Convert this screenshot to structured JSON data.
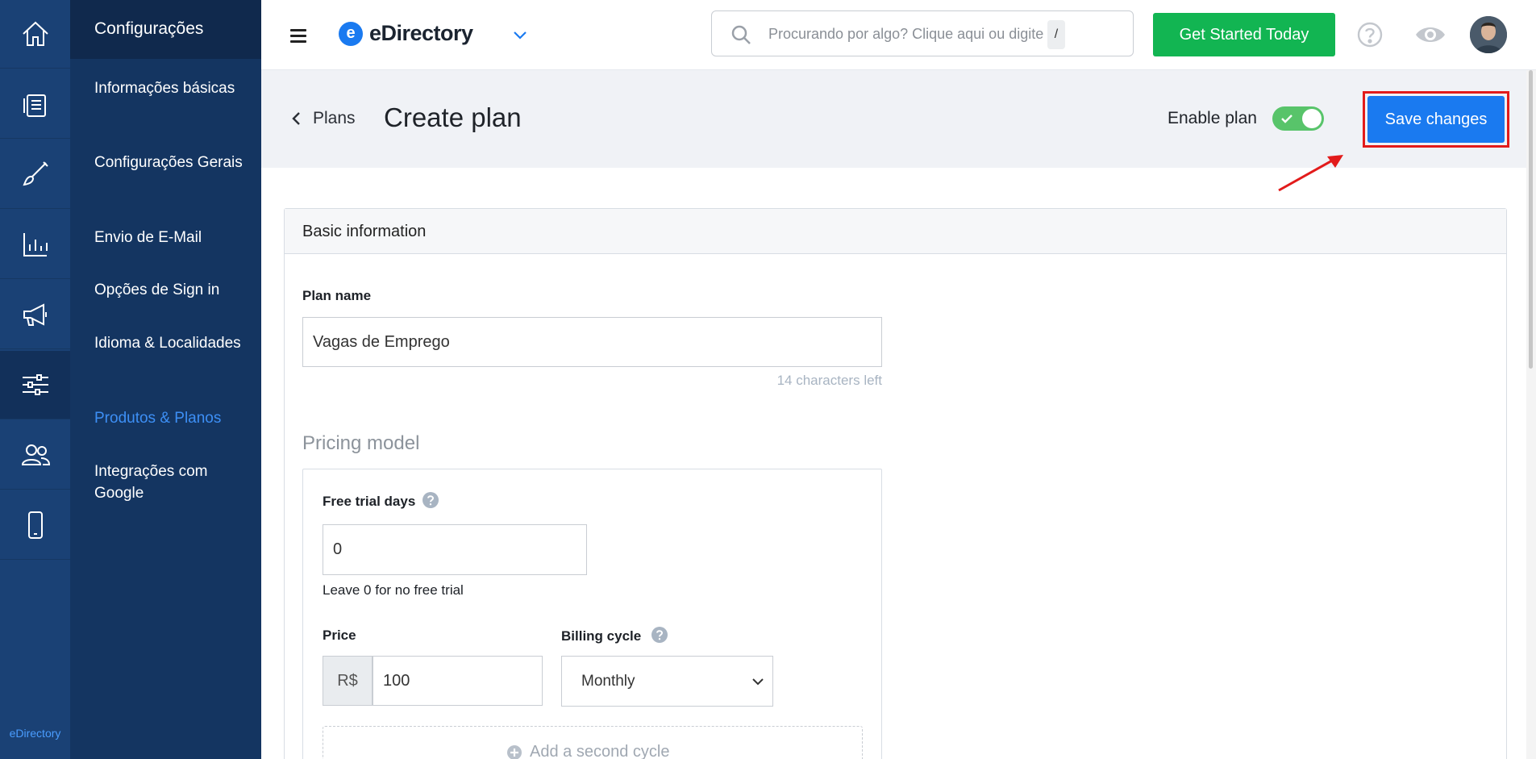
{
  "rail": {
    "items": [
      {
        "icon": "home-icon"
      },
      {
        "icon": "documents-icon"
      },
      {
        "icon": "brush-icon"
      },
      {
        "icon": "chart-icon"
      },
      {
        "icon": "megaphone-icon"
      },
      {
        "icon": "sliders-icon",
        "active": true
      },
      {
        "icon": "users-icon"
      },
      {
        "icon": "mobile-icon"
      }
    ],
    "footer_label": "eDirectory"
  },
  "menu": {
    "header": "Configurações",
    "items": [
      {
        "label": "Informações básicas"
      },
      {
        "label": "Configurações Gerais"
      },
      {
        "label": "Envio de E-Mail"
      },
      {
        "label": "Opções de Sign in"
      },
      {
        "label": "Idioma & Localidades"
      },
      {
        "label": "Produtos & Planos",
        "active": true
      },
      {
        "label": "Integrações com Google"
      }
    ]
  },
  "topbar": {
    "brand": "eDirectory",
    "brand_mark": "e",
    "search": {
      "placeholder": "Procurando por algo? Clique aqui ou digite",
      "shortcut": "/"
    },
    "cta_label": "Get Started Today"
  },
  "header": {
    "back_label": "Plans",
    "title": "Create plan",
    "enable_label": "Enable plan",
    "enabled": true,
    "save_label": "Save changes"
  },
  "form": {
    "section_title": "Basic information",
    "plan_name": {
      "label": "Plan name",
      "value": "Vagas de Emprego",
      "counter": "14 characters left"
    },
    "pricing_title": "Pricing model",
    "trial": {
      "label": "Free trial days",
      "value": "0",
      "hint": "Leave 0 for no free trial"
    },
    "price": {
      "label": "Price",
      "currency": "R$",
      "value": "100"
    },
    "billing": {
      "label": "Billing cycle",
      "selected": "Monthly"
    },
    "add_cycle_label": "Add a second cycle"
  },
  "colors": {
    "rail_bg": "#1a4175",
    "menu_bg": "#143561",
    "accent": "#1a7af0",
    "cta": "#12b552",
    "toggle_on": "#58c46a",
    "highlight": "#e21b1b"
  }
}
